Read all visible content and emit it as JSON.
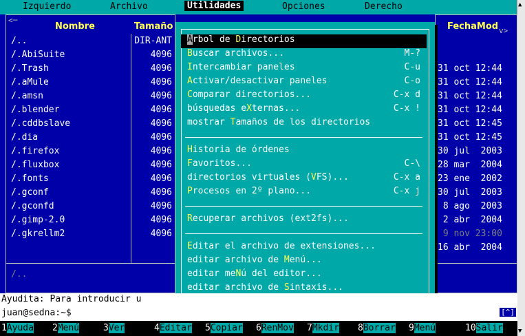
{
  "menubar": {
    "items": [
      "Izquierdo",
      "Archivo",
      "Utilidades",
      "Opciones",
      "Derecho"
    ],
    "active": "Utilidades"
  },
  "left_panel": {
    "corner": "<─",
    "headers": {
      "name": "Nombre",
      "size": "Tamaño"
    },
    "rows": [
      {
        "name": "/..",
        "size": "DIR-ANT"
      },
      {
        "name": "/.AbiSuite",
        "size": "4096"
      },
      {
        "name": "/.Trash",
        "size": "4096"
      },
      {
        "name": "/.aMule",
        "size": "4096"
      },
      {
        "name": "/.amsn",
        "size": "4096"
      },
      {
        "name": "/.blender",
        "size": "4096"
      },
      {
        "name": "/.cddbslave",
        "size": "4096"
      },
      {
        "name": "/.dia",
        "size": "4096"
      },
      {
        "name": "/.firefox",
        "size": "4096"
      },
      {
        "name": "/.fluxbox",
        "size": "4096"
      },
      {
        "name": "/.fonts",
        "size": "4096"
      },
      {
        "name": "/.gconf",
        "size": "4096"
      },
      {
        "name": "/.gconfd",
        "size": "4096"
      },
      {
        "name": "/.gimp-2.0",
        "size": "4096"
      },
      {
        "name": "/.gkrellm2",
        "size": "4096"
      }
    ],
    "status": "/.."
  },
  "right_panel": {
    "corner": "v>",
    "header": "FechaMod",
    "rows": [
      "31 oct 12:44",
      "31 oct 12:44",
      "31 oct 12:44",
      "31 oct 12:44",
      "31 oct 12:45",
      "31 oct 12:45",
      "30 jul  2003",
      "28 mar  2004",
      "23 ene  2002",
      "30 jul  2003",
      " 8 ago  2003",
      " 2 abr  2004",
      " 9 nov 23:00",
      "16 abr  2004"
    ]
  },
  "menu": {
    "items": [
      {
        "pre": "",
        "cur": "Á",
        "hk": "",
        "post": "rbol de ",
        "hk2": "D",
        "post2": "irectorios",
        "sc": "",
        "sel": true
      },
      {
        "pre": "",
        "hk": "B",
        "post": "uscar archivos...",
        "sc": "M-?"
      },
      {
        "pre": "",
        "hk": "I",
        "post": "ntercambiar paneles",
        "sc": "C-u"
      },
      {
        "pre": "",
        "hk": "A",
        "post": "ctivar/desactivar paneles",
        "sc": "C-o"
      },
      {
        "pre": "",
        "hk": "C",
        "post": "omparar directorios...",
        "sc": "C-x d"
      },
      {
        "pre": "búsquedas e",
        "hk": "X",
        "post": "ternas...",
        "sc": "C-x !"
      },
      {
        "pre": "mostrar ",
        "hk": "T",
        "post": "amaños de los directorios",
        "sc": ""
      },
      {
        "sep": true
      },
      {
        "pre": "",
        "hk": "H",
        "post": "istoria de órdenes",
        "sc": ""
      },
      {
        "pre": "",
        "hk": "F",
        "post": "avoritos...",
        "sc": "C-\\"
      },
      {
        "pre": "directorios virtuales (",
        "hk": "V",
        "post": "FS)...",
        "sc": "C-x a"
      },
      {
        "pre": "",
        "hk": "P",
        "post": "rocesos en 2º plano...",
        "sc": "C-x j"
      },
      {
        "sep": true
      },
      {
        "pre": "",
        "hk": "R",
        "post": "ecuperar archivos (ext2fs)...",
        "sc": ""
      },
      {
        "sep": true
      },
      {
        "pre": "",
        "hk": "E",
        "post": "ditar el archivo de extensiones...",
        "sc": ""
      },
      {
        "pre": "editar archivo de ",
        "hk": "M",
        "post": "enú...",
        "sc": ""
      },
      {
        "pre": "editar me",
        "hk": "N",
        "post": "ú del editor...",
        "sc": ""
      },
      {
        "pre": "editar archivo de ",
        "hk": "S",
        "post": "intaxis...",
        "sc": ""
      }
    ]
  },
  "hint": "Ayudita: Para introducir u",
  "prompt": "juan@sedna:~$",
  "caret_label": "[^]",
  "fkeys": [
    {
      "n": "1",
      "l": "Ayuda"
    },
    {
      "n": "2",
      "l": "Menú"
    },
    {
      "n": "3",
      "l": "Ver"
    },
    {
      "n": "4",
      "l": "Editar"
    },
    {
      "n": "5",
      "l": "Copiar"
    },
    {
      "n": "6",
      "l": "RenMov"
    },
    {
      "n": "7",
      "l": "Mkdir"
    },
    {
      "n": "8",
      "l": "Borrar"
    },
    {
      "n": "9",
      "l": "Menú"
    },
    {
      "n": "10",
      "l": "Salir"
    }
  ],
  "colors": {
    "bg": "#0000a8",
    "accent": "#00a8a8",
    "hotkey": "#ffff54"
  }
}
